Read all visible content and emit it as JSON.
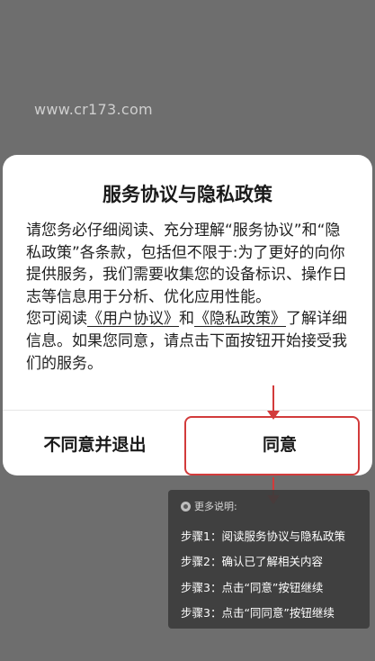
{
  "watermark": "www.cr173.com",
  "dialog": {
    "title": "服务协议与隐私政策",
    "body_p1": "请您务必仔细阅读、充分理解“服务协议”和“隐私政策”各条款，包括但不限于:为了更好的向你提供服务，我们需要收集您的设备标识、操作日志等信息用于分析、优化应用性能。",
    "body_p2_prefix": "您可阅读",
    "link_user_agreement": "《用户协议》",
    "body_p2_and": "和",
    "link_privacy_policy": "《隐私政策》",
    "body_p2_suffix": "了解详细信息。如果您同意，请点击下面按钮开始接受我们的服务。",
    "exit_label": "不同意并退出",
    "agree_label": "同意"
  },
  "annotation": {
    "header": "更多说明:",
    "icon": "info-icon",
    "steps": [
      "步骤1：阅读服务协议与隐私政策",
      "步骤2：确认已了解相关内容",
      "步骤3：点击“同意”按钮继续",
      "步骤3：点击“同同意”按钮继续"
    ],
    "highlight_color": "#d23b3b"
  }
}
